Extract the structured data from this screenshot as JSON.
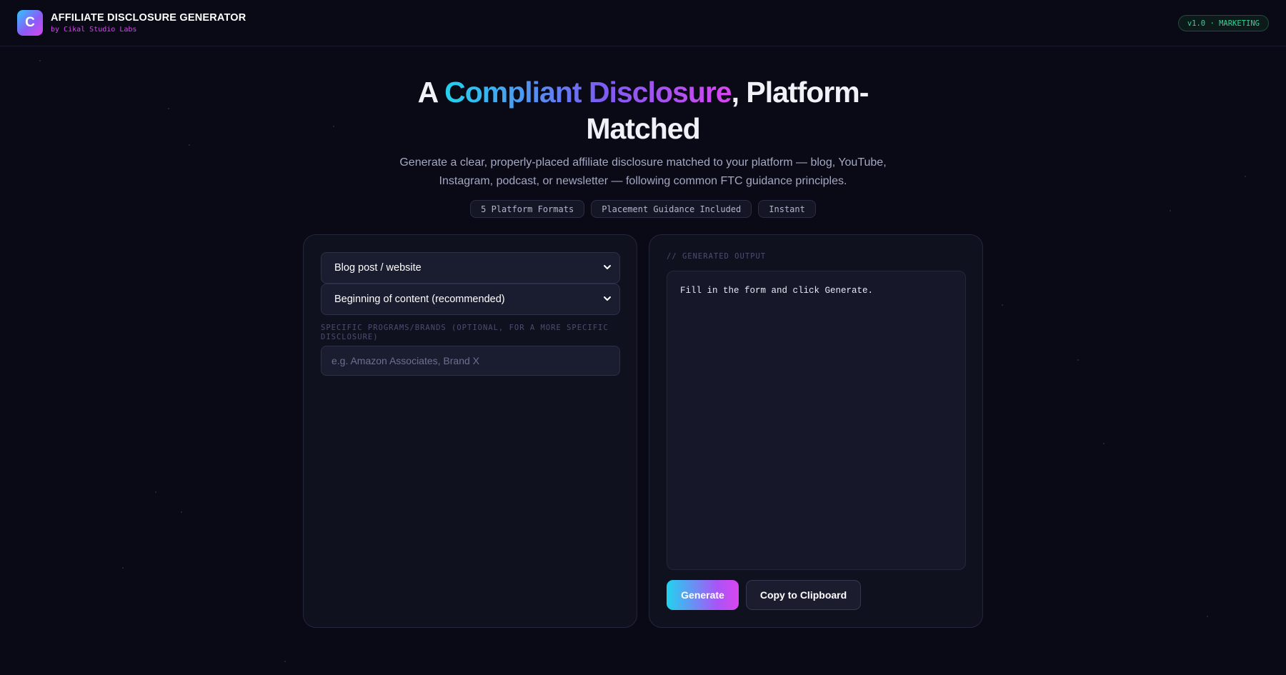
{
  "header": {
    "logo_letter": "C",
    "app_title": "AFFILIATE DISCLOSURE GENERATOR",
    "byline": "by Cikal Studio Labs",
    "version_badge": "v1.0 · MARKETING"
  },
  "hero": {
    "title_prefix": "A ",
    "title_highlight": "Compliant Disclosure",
    "title_suffix_line1": ", Platform-",
    "title_line2": "Matched",
    "description": "Generate a clear, properly-placed affiliate disclosure matched to your platform — blog, YouTube, Instagram, podcast, or newsletter — following common FTC guidance principles.",
    "chips": [
      "5 Platform Formats",
      "Placement Guidance Included",
      "Instant"
    ]
  },
  "form": {
    "platform_select": "Blog post / website",
    "placement_select": "Beginning of content (recommended)",
    "programs_label": "SPECIFIC PROGRAMS/BRANDS (OPTIONAL, FOR A MORE SPECIFIC DISCLOSURE)",
    "programs_placeholder": "e.g. Amazon Associates, Brand X",
    "programs_value": ""
  },
  "output": {
    "label": "// GENERATED OUTPUT",
    "text": "Fill in the form and click Generate.",
    "generate_label": "Generate",
    "copy_label": "Copy to Clipboard"
  },
  "icons": {
    "logo": "logo-mark",
    "select_caret": "chevron-down-icon"
  },
  "colors": {
    "background": "#090a16",
    "panel": "#10111f",
    "accent_cyan": "#22d3ee",
    "accent_purple": "#7c5cf2",
    "accent_magenta": "#d946ef",
    "badge_green": "#34d399"
  }
}
